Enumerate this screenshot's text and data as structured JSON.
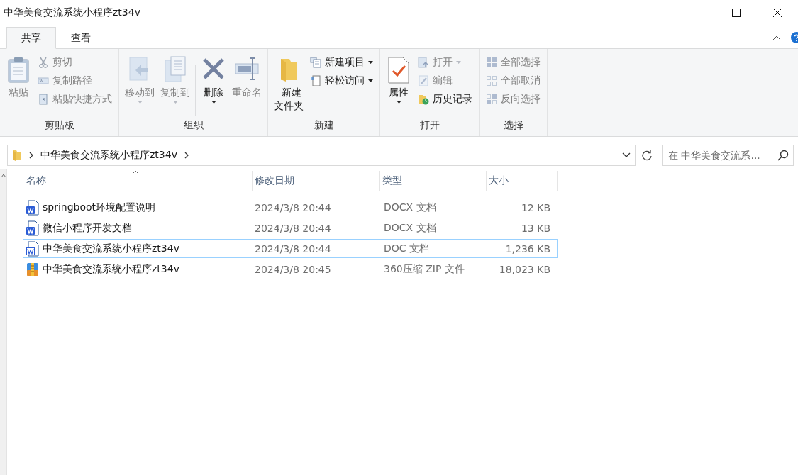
{
  "window": {
    "title": "中华美食交流系统小程序zt34v"
  },
  "tabs": [
    {
      "label": "共享",
      "selected": true
    },
    {
      "label": "查看",
      "selected": false
    }
  ],
  "ribbon": {
    "groups": [
      {
        "label": "剪贴板",
        "items": [
          {
            "kind": "large",
            "label": "粘贴",
            "disabled": true
          },
          {
            "kind": "small",
            "label": "剪切",
            "disabled": true
          },
          {
            "kind": "small",
            "label": "复制路径",
            "disabled": true
          },
          {
            "kind": "small",
            "label": "粘贴快捷方式",
            "disabled": true
          }
        ]
      },
      {
        "label": "组织",
        "items": [
          {
            "kind": "large",
            "label": "移动到",
            "disabled": true,
            "dropdown": true
          },
          {
            "kind": "large",
            "label": "复制到",
            "disabled": true,
            "dropdown": true
          },
          {
            "kind": "large",
            "label": "删除",
            "disabled": false,
            "dropdown": true,
            "divider_before": true
          },
          {
            "kind": "large",
            "label": "重命名",
            "disabled": true
          }
        ]
      },
      {
        "label": "新建",
        "items": [
          {
            "kind": "large",
            "label": "新建文件夹",
            "disabled": false
          },
          {
            "kind": "small",
            "label": "新建项目",
            "disabled": false,
            "dropdown": true
          },
          {
            "kind": "small",
            "label": "轻松访问",
            "disabled": false,
            "dropdown": true
          }
        ]
      },
      {
        "label": "打开",
        "items": [
          {
            "kind": "large",
            "label": "属性",
            "disabled": false,
            "dropdown": true
          },
          {
            "kind": "small",
            "label": "打开",
            "disabled": true,
            "dropdown": true
          },
          {
            "kind": "small",
            "label": "编辑",
            "disabled": true
          },
          {
            "kind": "small",
            "label": "历史记录",
            "disabled": false
          }
        ]
      },
      {
        "label": "选择",
        "items": [
          {
            "kind": "small",
            "label": "全部选择",
            "disabled": true
          },
          {
            "kind": "small",
            "label": "全部取消",
            "disabled": true
          },
          {
            "kind": "small",
            "label": "反向选择",
            "disabled": true
          }
        ]
      }
    ]
  },
  "address": {
    "path": [
      "中华美食交流系统小程序zt34v"
    ]
  },
  "search": {
    "placeholder": "在 中华美食交流系..."
  },
  "columns": [
    {
      "label": "名称",
      "sorted": true
    },
    {
      "label": "修改日期"
    },
    {
      "label": "类型"
    },
    {
      "label": "大小"
    }
  ],
  "rows": [
    {
      "kind": "docx",
      "name": "springboot环境配置说明",
      "date": "2024/3/8 20:44",
      "type": "DOCX 文档",
      "size": "12 KB",
      "focused": false
    },
    {
      "kind": "docx",
      "name": "微信小程序开发文档",
      "date": "2024/3/8 20:44",
      "type": "DOCX 文档",
      "size": "13 KB",
      "focused": false
    },
    {
      "kind": "doc",
      "name": "中华美食交流系统小程序zt34v",
      "date": "2024/3/8 20:44",
      "type": "DOC 文档",
      "size": "1,236 KB",
      "focused": true
    },
    {
      "kind": "zip",
      "name": "中华美食交流系统小程序zt34v",
      "date": "2024/3/8 20:45",
      "type": "360压缩 ZIP 文件",
      "size": "18,023 KB",
      "focused": false
    }
  ]
}
